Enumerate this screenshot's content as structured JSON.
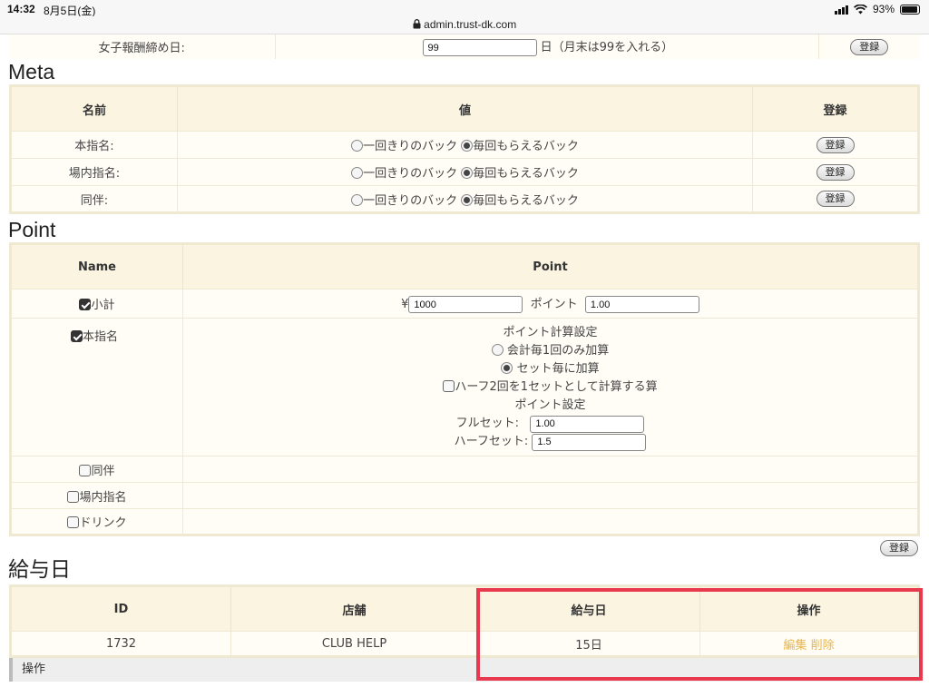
{
  "status_bar": {
    "time": "14:32",
    "date": "8月5日(金)",
    "battery": "93%"
  },
  "browser": {
    "url": "admin.trust-dk.com"
  },
  "top_row": {
    "label": "女子報酬締め日:",
    "value": "99",
    "hint": "日（月末は99を入れる）",
    "button": "登録"
  },
  "meta": {
    "title": "Meta",
    "headers": [
      "名前",
      "値",
      "登録"
    ],
    "option_a": "一回きりのバック",
    "option_b": "毎回もらえるバック",
    "rows": [
      {
        "name": "本指名:",
        "button": "登録"
      },
      {
        "name": "場内指名:",
        "button": "登録"
      },
      {
        "name": "同伴:",
        "button": "登録"
      }
    ]
  },
  "point": {
    "title": "Point",
    "headers": [
      "Name",
      "Point"
    ],
    "subtotal": {
      "label": "小計",
      "yen_symbol": "¥",
      "yen_value": "1000",
      "point_label": "ポイント",
      "point_value": "1.00"
    },
    "honshimei": {
      "label": "本指名",
      "calc_title": "ポイント計算設定",
      "calc_opt1": "会計毎1回のみ加算",
      "calc_opt2": "セット毎に加算",
      "half_check": "ハーフ2回を1セットとして計算する算",
      "setting_title": "ポイント設定",
      "full_label": "フルセット:",
      "full_value": "1.00",
      "half_label": "ハーフセット:",
      "half_value": "1.5"
    },
    "extra_rows": [
      "同伴",
      "場内指名",
      "ドリンク"
    ],
    "submit": "登録"
  },
  "payday": {
    "title": "給与日",
    "headers": [
      "ID",
      "店舗",
      "給与日",
      "操作"
    ],
    "row": {
      "id": "1732",
      "store": "CLUB HELP",
      "day": "15日",
      "edit": "編集",
      "delete": "削除"
    },
    "footer": "操作"
  }
}
